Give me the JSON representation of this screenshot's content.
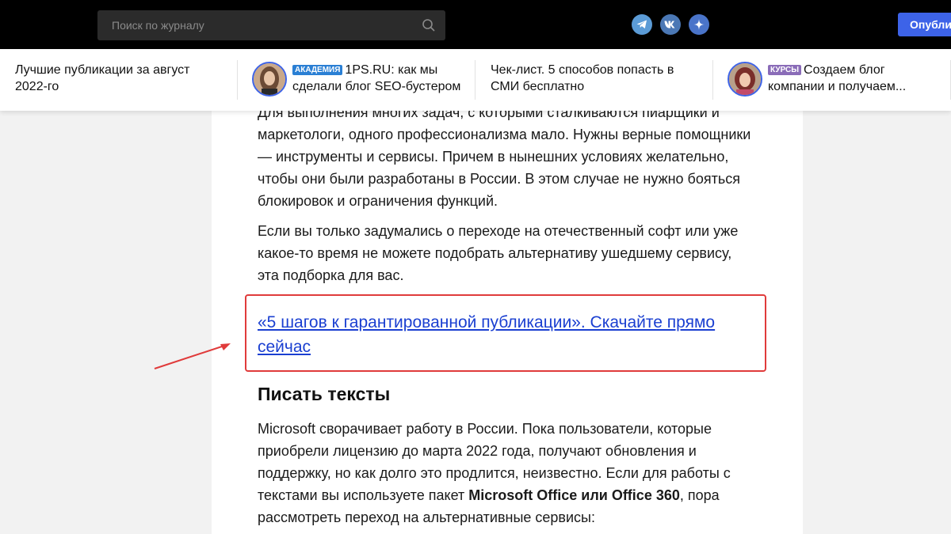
{
  "header": {
    "search_placeholder": "Поиск по журналу",
    "publish_label": "Опубликовать",
    "social": [
      "telegram-icon",
      "vk-icon",
      "dzen-icon"
    ]
  },
  "featured": [
    {
      "text": "Лучшие публикации за август 2022-го"
    },
    {
      "badge": "АКАДЕМИЯ",
      "text": "1PS.RU: как мы сделали блог SEO-бустером"
    },
    {
      "text": "Чек-лист. 5 способов попасть в СМИ бесплатно"
    },
    {
      "badge": "КУРСЫ",
      "text": "Создаем блог компании и получаем..."
    }
  ],
  "article": {
    "p1": "Для выполнения многих задач, с которыми сталкиваются пиарщики и маркетологи, одного профессионализма мало. Нужны верные помощники — инструменты и сервисы. Причем в нынешних условиях желательно, чтобы они были разработаны в России. В этом случае не нужно бояться блокировок и ограничения функций.",
    "p2": "Если вы только задумались о переходе на отечественный софт или уже какое-то время не можете подобрать альтернативу ушедшему сервису, эта подборка для вас.",
    "cta": "«5 шагов к гарантированной публикации». Скачайте прямо сейчас",
    "h2": "Писать тексты",
    "p3_a": "Microsoft сворачивает работу в России. Пока пользователи, которые приобрели лицензию до марта 2022 года, получают обновления и поддержку, но как долго это продлится, неизвестно. Если для работы с текстами вы используете пакет ",
    "p3_bold": "Microsoft Office или Office 360",
    "p3_b": ", пора рассмотреть переход на альтернативные сервисы:"
  },
  "colors": {
    "accent": "#3d63e8",
    "link": "#1a3fd1",
    "highlight_border": "#e03b3b"
  }
}
